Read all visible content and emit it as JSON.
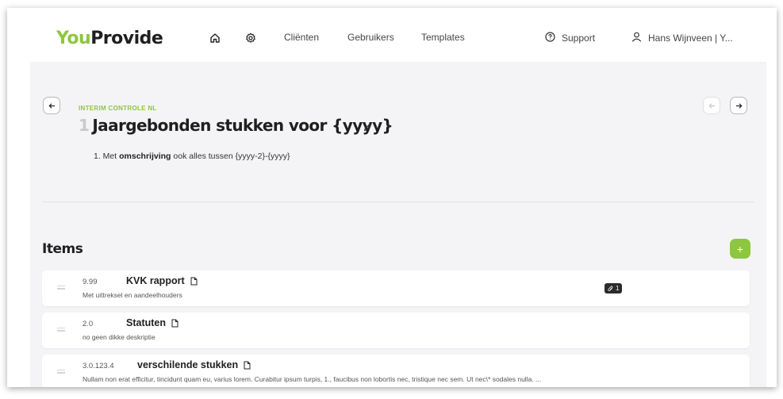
{
  "header": {
    "logo_you": "You",
    "logo_rest": "Provide",
    "nav": [
      {
        "label": "Cliënten"
      },
      {
        "label": "Gebruikers"
      },
      {
        "label": "Templates"
      }
    ],
    "support_label": "Support",
    "user_label": "Hans Wijnveen | Y..."
  },
  "task": {
    "eyebrow": "INTERIM CONTROLE NL",
    "number": "1",
    "title": "Jaargebonden stukken voor {yyyy}",
    "desc_prefix": "1. Met ",
    "desc_bold": "omschrijving",
    "desc_suffix": " ook alles tussen {yyyy-2}-{yyyy}"
  },
  "items": {
    "heading": "Items",
    "add_label": "+",
    "rows": [
      {
        "code": "9.99",
        "name": "KVK rapport",
        "sub": "Met uittreksel en aandeelhouders",
        "attachments": "1"
      },
      {
        "code": "2.0",
        "name": "Statuten",
        "sub": "no geen dikke deskriptie"
      },
      {
        "code": "3.0.123.4",
        "name": "verschilende stukken",
        "sub": "Nullam non erat efficitur, tincidunt quam eu, varius lorem. Curabitur ipsum turpis, 1., faucibus non lobortis nec, tristique nec sem. Ut nec\\* sodales nulla. ..."
      }
    ]
  },
  "colors": {
    "accent": "#8dc63f",
    "background": "#f4f4f6"
  }
}
